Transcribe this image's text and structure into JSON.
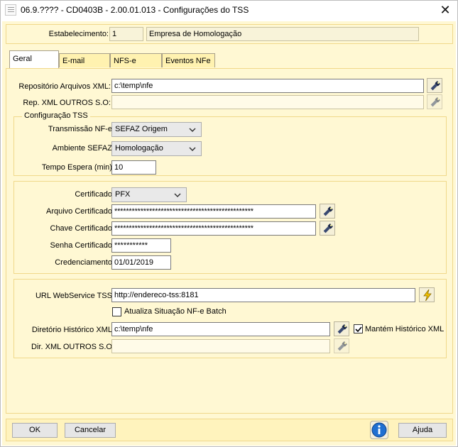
{
  "window": {
    "title": "06.9.???? - CD0403B - 2.00.01.013 - Configurações do TSS",
    "close_glyph": "✕",
    "app_icon": "document-icon"
  },
  "header": {
    "estabelecimento_label": "Estabelecimento:",
    "estabelecimento_code": "1",
    "estabelecimento_name": "Empresa de Homologação"
  },
  "tabs": [
    {
      "label": "Geral",
      "active": true
    },
    {
      "label": "E-mail",
      "active": false
    },
    {
      "label": "NFS-e",
      "active": false
    },
    {
      "label": "Eventos NFe",
      "active": false
    }
  ],
  "geral": {
    "repositorio_label": "Repositório Arquivos XML:",
    "repositorio_value": "c:\\temp\\nfe",
    "rep_outros_label": "Rep. XML OUTROS S.O:",
    "rep_outros_value": "",
    "config_tss_title": "Configuração TSS",
    "transmissao_label": "Transmissão NF-e:",
    "transmissao_value": "SEFAZ Origem",
    "ambiente_label": "Ambiente SEFAZ:",
    "ambiente_value": "Homologação",
    "tempo_label": "Tempo Espera (min):",
    "tempo_value": "10",
    "certificado_label": "Certificado:",
    "certificado_value": "PFX",
    "arquivo_cert_label": "Arquivo Certificado:",
    "arquivo_cert_value": "************************************************",
    "chave_cert_label": "Chave Certificado:",
    "chave_cert_value": "************************************************",
    "senha_cert_label": "Senha Certificado:",
    "senha_cert_value": "***********",
    "credenciamento_label": "Credenciamento:",
    "credenciamento_value": "01/01/2019",
    "url_label": "URL WebService TSS:",
    "url_value": "http://endereco-tss:8181",
    "atualiza_label": "Atualiza Situação NF-e Batch",
    "atualiza_checked": false,
    "dir_historico_label": "Diretório Histórico XML:",
    "dir_historico_value": "c:\\temp\\nfe",
    "mantem_label": "Mantém Histórico XML",
    "mantem_checked": true,
    "dir_outros_label": "Dir. XML OUTROS S.O:",
    "dir_outros_value": ""
  },
  "footer": {
    "ok_label": "OK",
    "cancelar_label": "Cancelar",
    "ajuda_label": "Ajuda"
  },
  "colors": {
    "background": "#fff8d3",
    "panel_border": "#f0d88a",
    "footer_bg": "#fff3bd",
    "info_blue": "#1f6fd1",
    "bolt_yellow": "#f2c200"
  }
}
